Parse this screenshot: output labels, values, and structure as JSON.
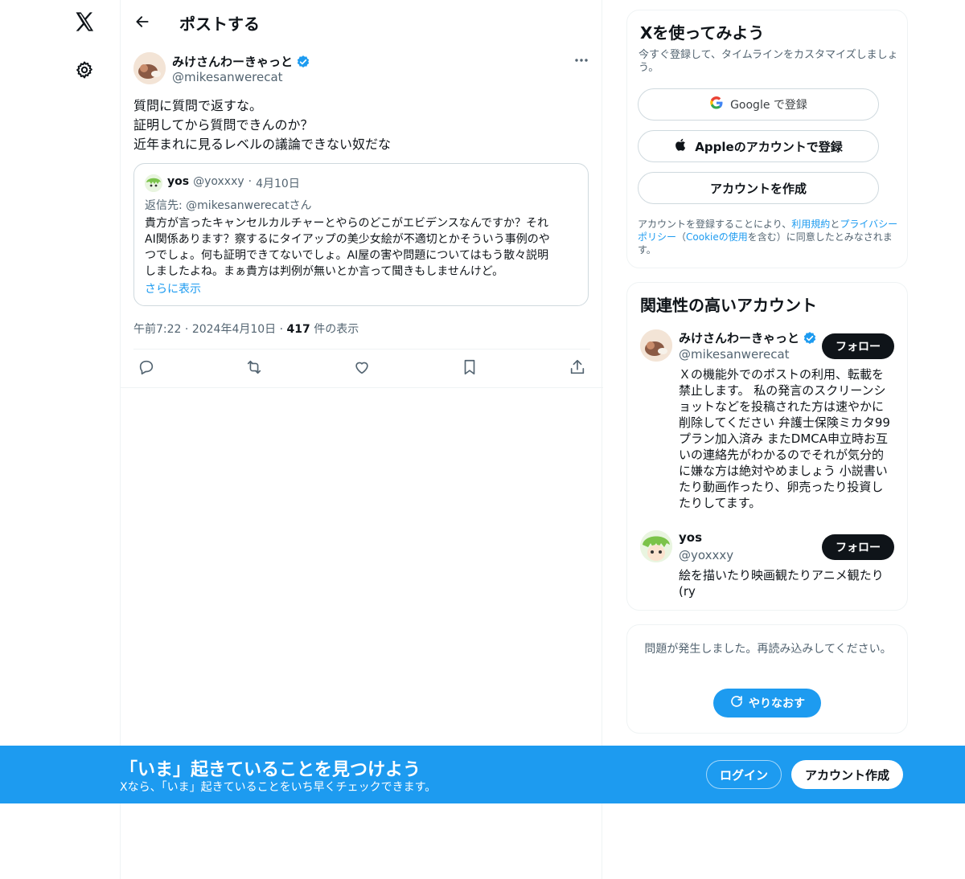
{
  "nav": {
    "logo_icon": "x-logo-icon",
    "settings_icon": "gear-icon"
  },
  "header": {
    "title": "ポストする",
    "back_icon": "arrow-left-icon"
  },
  "post": {
    "author_name": "みけさんわーきゃっと",
    "author_handle": "@mikesanwerecat",
    "text_lines": [
      "質問に質問で返すな。",
      "証明してから質問できんのか？",
      "近年まれに見るレベルの議論できない奴だな"
    ],
    "quote": {
      "name": "yos",
      "handle": "@yoxxxy",
      "sep": "·",
      "date": "4月10日",
      "reply_to": "返信先: @mikesanwerecatさん",
      "body_lines": [
        "貴方が言ったキャンセルカルチャーとやらのどこがエビデンスなんですか？それ",
        "AI関係あります？察するにタイアップの美少女絵が不適切とかそういう事例のや",
        "つでしょ。何も証明できてないでしょ。AI屋の害や問題についてはもう散々説明",
        "しましたよね。まぁ貴方は判例が無いとか言って聞きもしませんけど。"
      ],
      "show_more": "さらに表示"
    },
    "meta": {
      "time": "午前7:22",
      "date": "2024年4月10日",
      "sep": "·",
      "views_count": "417",
      "views_label": "件の表示"
    },
    "actions": [
      "reply-icon",
      "repost-icon",
      "like-icon",
      "bookmark-icon",
      "share-icon"
    ]
  },
  "signup": {
    "title": "Xを使ってみよう",
    "subtitle": "今すぐ登録して、タイムラインをカスタマイズしましょう。",
    "google_label": "Google で登録",
    "apple_label": "Appleのアカウントで登録",
    "create_label": "アカウントを作成",
    "terms_pre": "アカウントを登録することにより、",
    "terms_link1": "利用規約",
    "terms_and": "と",
    "terms_link2": "プライバシーポリシー",
    "terms_mid": "（",
    "terms_link3": "Cookieの使用",
    "terms_post": "を含む）に同意したとみなされます。"
  },
  "related": {
    "title": "関連性の高いアカウント",
    "accounts": [
      {
        "name": "みけさんわーきゃっと",
        "handle": "@mikesanwerecat",
        "follow": "フォロー",
        "bio_lines": [
          "Ｘの機能外でのポストの利用、転載を",
          "禁止します。 私の発言のスクリーンシ",
          "ョットなどを投稿された方は速やかに",
          "削除してください 弁護士保険ミカタ99",
          "プラン加入済み またDMCA申立時お互",
          "いの連絡先がわかるのでそれが気分的",
          "に嫌な方は絶対やめましょう 小説書い",
          "たり動画作ったり、卵売ったり投資し",
          "たりしてます。"
        ]
      },
      {
        "name": "yos",
        "handle": "@yoxxxy",
        "follow": "フォロー",
        "bio_lines": [
          "絵を描いたり映画観たりアニメ観たり",
          "(ry"
        ]
      }
    ]
  },
  "error": {
    "message": "問題が発生しました。再読み込みしてください。",
    "retry": "やりなおす"
  },
  "bottom_bar": {
    "title": "「いま」起きていることを見つけよう",
    "subtitle": "Xなら、「いま」起きていることをいち早くチェックできます。",
    "login": "ログイン",
    "signup": "アカウント作成"
  },
  "colors": {
    "accent": "#1d9bf0",
    "text": "#0f1419",
    "muted": "#536471",
    "border": "#cfd9de"
  }
}
